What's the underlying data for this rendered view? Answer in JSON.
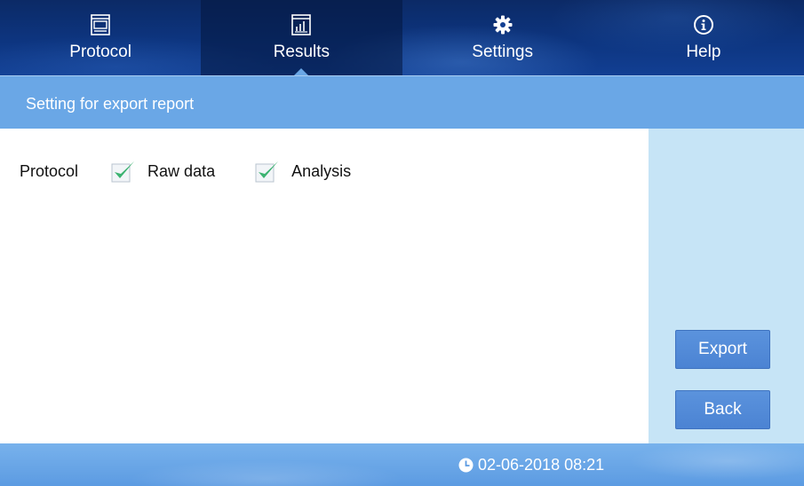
{
  "nav": {
    "tabs": [
      {
        "label": "Protocol",
        "icon": "window-icon",
        "active": false
      },
      {
        "label": "Results",
        "icon": "bar-chart-icon",
        "active": true
      },
      {
        "label": "Settings",
        "icon": "gear-icon",
        "active": false
      },
      {
        "label": "Help",
        "icon": "info-icon",
        "active": false
      }
    ]
  },
  "title": "Setting for export report",
  "options": {
    "label": "Protocol",
    "items": [
      {
        "label": "Raw data",
        "checked": true
      },
      {
        "label": "Analysis",
        "checked": true
      }
    ]
  },
  "actions": {
    "export": "Export",
    "back": "Back"
  },
  "status": {
    "datetime": "02-06-2018 08:21"
  },
  "colors": {
    "nav_bg": "#0d3580",
    "title_bar": "#6aa7e6",
    "side_panel": "#c6e4f6",
    "button": "#4b83d3",
    "check": "#3cb371"
  }
}
